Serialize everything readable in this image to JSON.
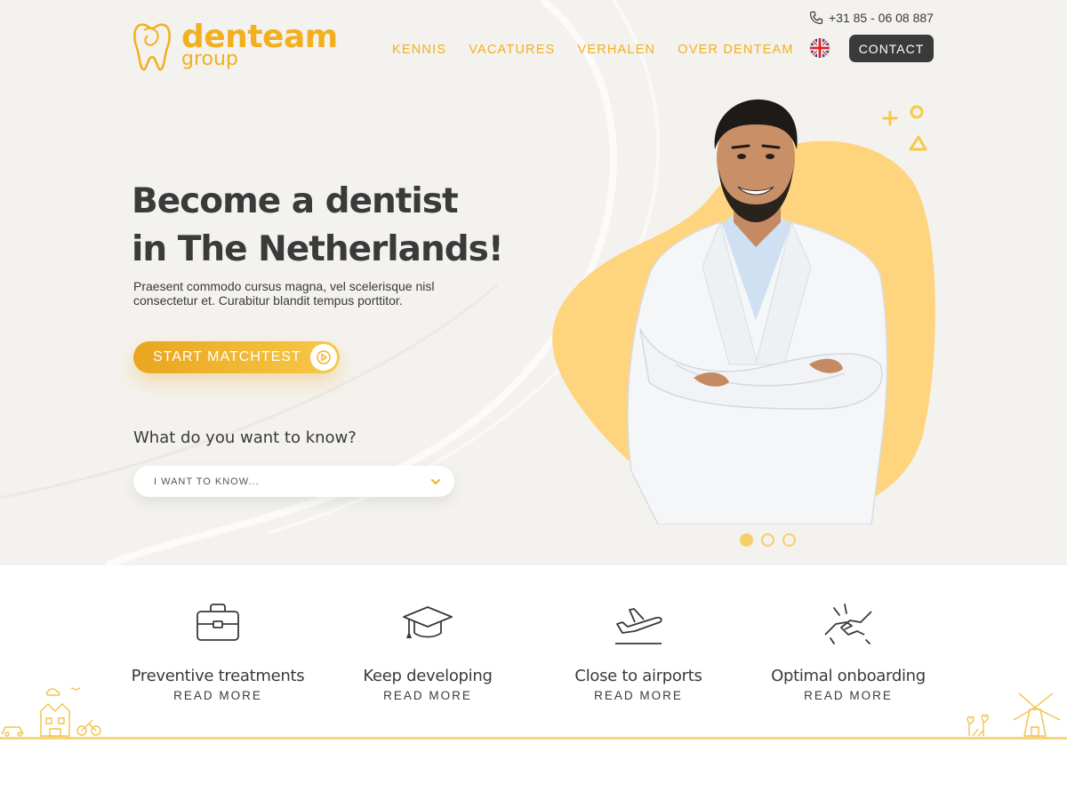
{
  "brand": {
    "name": "denteam",
    "sub": "group",
    "color": "#f2b01e"
  },
  "header": {
    "phone": "+31 85 - 06 08 887",
    "nav": [
      "KENNIS",
      "VACATURES",
      "VERHALEN",
      "OVER DENTEAM"
    ],
    "language_icon": "uk-flag-icon",
    "contact_label": "CONTACT"
  },
  "hero": {
    "title_line1": "Become a dentist",
    "title_line2": "in The Netherlands!",
    "description": "Praesent commodo cursus magna, vel scelerisque nisl consectetur et. Curabitur blandit tempus porttitor.",
    "cta_label": "START MATCHTEST",
    "question": "What do you want to know?",
    "select_placeholder": "I WANT TO KNOW...",
    "slider_dots": 3,
    "active_dot": 1
  },
  "features": [
    {
      "icon": "briefcase-icon",
      "title": "Preventive treatments",
      "link": "READ MORE"
    },
    {
      "icon": "graduation-cap-icon",
      "title": "Keep developing",
      "link": "READ MORE"
    },
    {
      "icon": "airplane-icon",
      "title": "Close to airports",
      "link": "READ MORE"
    },
    {
      "icon": "handshake-icon",
      "title": "Optimal onboarding",
      "link": "READ MORE"
    }
  ],
  "colors": {
    "accent": "#f2b01e",
    "dark": "#3a3a3a",
    "hero_bg": "#f4f2ee",
    "blob": "#fed57e"
  }
}
